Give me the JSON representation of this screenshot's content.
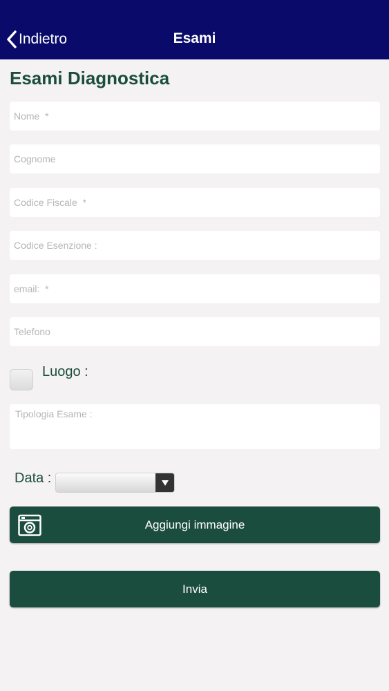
{
  "navbar": {
    "back_label": "Indietro",
    "title": "Esami"
  },
  "page": {
    "title": "Esami Diagnostica"
  },
  "form": {
    "nome_placeholder": "Nome  *",
    "cognome_placeholder": "Cognome",
    "codice_fiscale_placeholder": "Codice Fiscale  *",
    "codice_esenzione_placeholder": "Codice Esenzione :",
    "email_placeholder": "email:  *",
    "telefono_placeholder": "Telefono",
    "luogo_label": "Luogo :",
    "tipologia_placeholder": "Tipologia Esame :",
    "data_label": "Data :",
    "data_value": ""
  },
  "actions": {
    "add_image_label": "Aggiungi immagine",
    "send_label": "Invia"
  },
  "icons": {
    "back": "chevron-left-icon",
    "camera": "camera-icon",
    "dropdown": "triangle-down-icon"
  },
  "colors": {
    "navbar": "#0a0a6b",
    "accent_green": "#1b4d3e",
    "background": "#f4f2f2"
  }
}
